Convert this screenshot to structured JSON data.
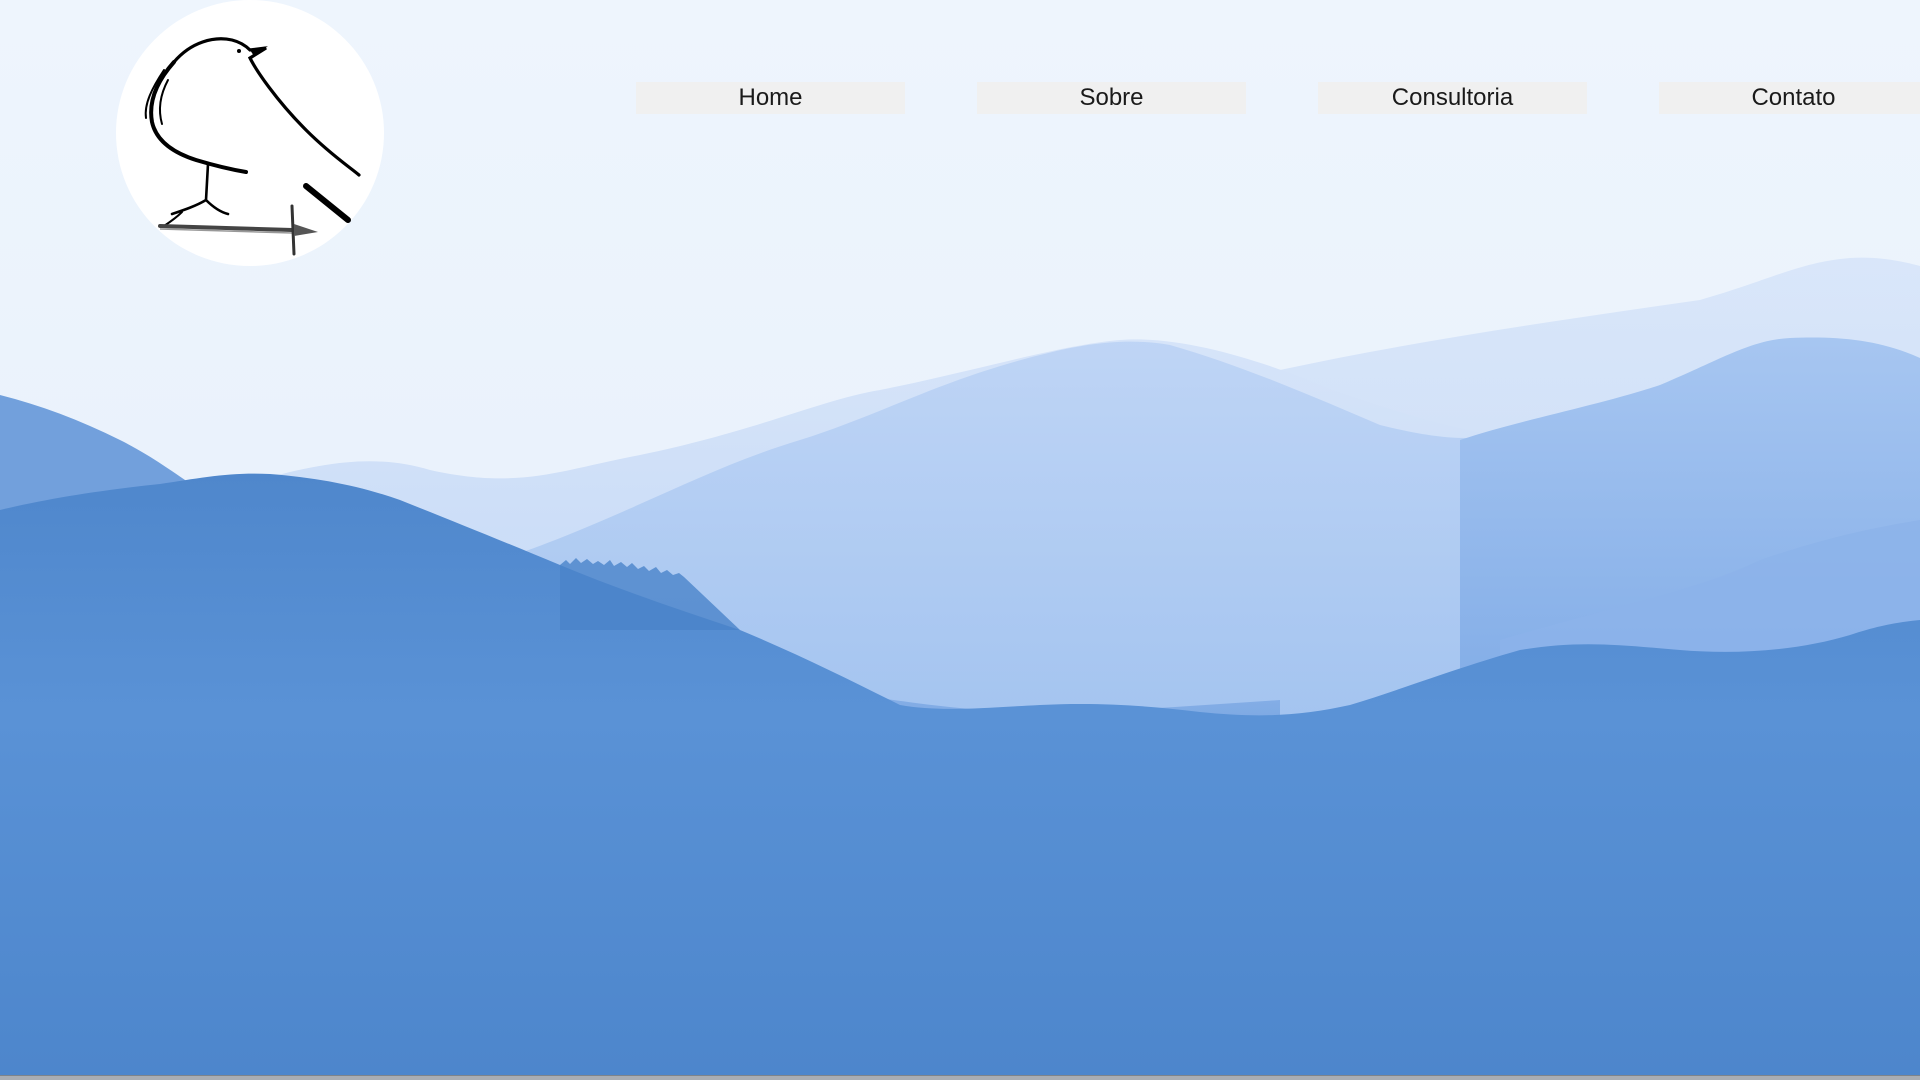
{
  "logo": {
    "icon": "raven-on-sword-icon"
  },
  "nav": {
    "items": [
      {
        "label": "Home"
      },
      {
        "label": "Sobre"
      },
      {
        "label": "Consultoria"
      },
      {
        "label": "Contato"
      }
    ],
    "background_color": "#f0f0f0"
  },
  "background": {
    "description_icon": "misty-blue-mountains-image",
    "colors": {
      "sky": "#eef5fc",
      "far_hills": "#c9dcf7",
      "mid_hills": "#a9c8f2",
      "near_hills": "#4b88d0"
    }
  }
}
